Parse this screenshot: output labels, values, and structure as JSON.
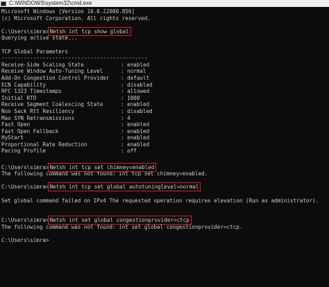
{
  "window": {
    "title": "C:\\WINDOWS\\system32\\cmd.exe"
  },
  "colors": {
    "background": "#0c0c0c",
    "text": "#cccccc",
    "highlight_box": "#e0201a"
  },
  "console": {
    "banner1": "Microsoft Windows [Version 10.0.22000.856]",
    "banner2": "(c) Microsoft Corporation. All rights reserved.",
    "prompt": "C:\\Users\\simra>",
    "cmd1": "Netsh int tcp show global",
    "querying": "Querying active state...",
    "section_title": "TCP Global Parameters",
    "separator": "----------------------------------------------",
    "params": [
      {
        "key": "Receive-Side Scaling State",
        "value": ": enabled"
      },
      {
        "key": "Receive Window Auto-Tuning Level",
        "value": ": normal"
      },
      {
        "key": "Add-On Congestion Control Provider",
        "value": ": default"
      },
      {
        "key": "ECN Capability",
        "value": ": disabled"
      },
      {
        "key": "RFC 1323 Timestamps",
        "value": ": allowed"
      },
      {
        "key": "Initial RTO",
        "value": ": 1000"
      },
      {
        "key": "Receive Segment Coalescing State",
        "value": ": enabled"
      },
      {
        "key": "Non Sack Rtt Resiliency",
        "value": ": disabled"
      },
      {
        "key": "Max SYN Retransmissions",
        "value": ": 4"
      },
      {
        "key": "Fast Open",
        "value": ": enabled"
      },
      {
        "key": "Fast Open Fallback",
        "value": ": enabled"
      },
      {
        "key": "HyStart",
        "value": ": enabled"
      },
      {
        "key": "Proportional Rate Reduction",
        "value": ": enabled"
      },
      {
        "key": "Pacing Profile",
        "value": ": off"
      }
    ],
    "cmd2": "Netsh int tcp set chimney=enabled",
    "out2": "The following command was not found: int tcp set chimney=enabled.",
    "cmd3": "Netsh int tcp set global autotuninglevel=normal",
    "out3": "Set global command failed on IPv4 The requested operation requires elevation (Run as administrator).",
    "cmd4": "Netsh int set global congestionprovider=ctcp",
    "out4": "The following command was not found: int set global congestionprovider=ctcp.",
    "final_prompt": "C:\\Users\\simra>"
  }
}
